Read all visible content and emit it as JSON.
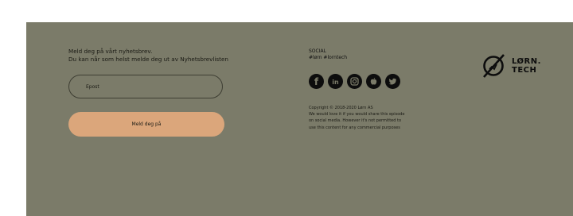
{
  "newsletter": {
    "line1": "Meld deg på vårt nyhetsbrev.",
    "line2": "Du kan når som helst melde deg ut av Nyhetsbrevlisten",
    "email_placeholder": "Epost",
    "submit_label": "Meld deg på"
  },
  "social": {
    "title": "SOCIAL",
    "hashtags": "#lørn #lorntech",
    "icons": [
      "facebook-icon",
      "linkedin-icon",
      "instagram-icon",
      "apple-icon",
      "twitter-icon"
    ]
  },
  "copyright": {
    "line1": "Copyright © 2018-2020 Lørn AS",
    "line2": "We would love it if you would share this episode",
    "line3": "on social media. However it's not permitted to",
    "line4": "use this content for any commercial purposes"
  },
  "brand": {
    "line1": "LØRN.",
    "line2": "TECH"
  },
  "colors": {
    "footer_bg": "#7b7b69",
    "button_bg": "#dba67b",
    "icon_bg": "#0d0d0d",
    "text": "#1a1a14"
  }
}
